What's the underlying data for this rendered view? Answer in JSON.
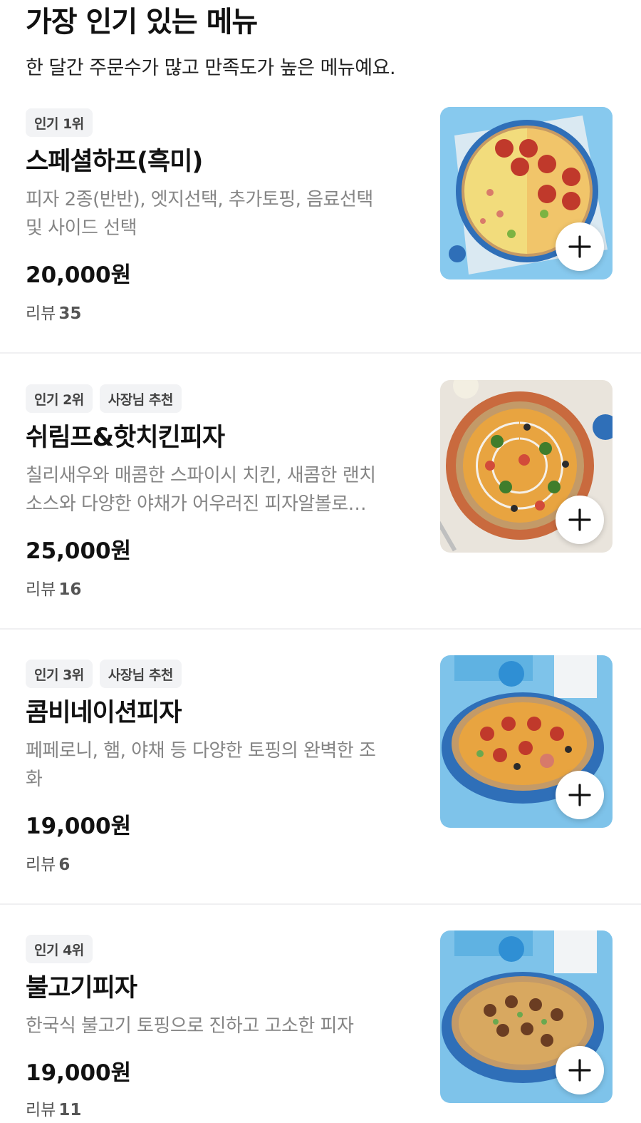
{
  "section": {
    "title": "가장 인기 있는 메뉴",
    "subtitle": "한 달간 주문수가 많고 만족도가 높은 메뉴예요."
  },
  "colors": {
    "badge_bg": "#f2f3f5",
    "divider": "#f0f0f2",
    "plate_blue": "#2f6fb8",
    "bg_blue": "#7ec3ea"
  },
  "items": [
    {
      "badges": [
        "인기 1위"
      ],
      "name": "스페셜하프(흑미)",
      "desc_lines": [
        "피자 2종(반반), 엣지선택, 추가토핑, 음료선택",
        "및 사이드 선택"
      ],
      "price": "20,000원",
      "reviews_label": "리뷰",
      "reviews_count": "35",
      "image_icon": "pizza-half-image"
    },
    {
      "badges": [
        "인기 2위",
        "사장님 추천"
      ],
      "name": "쉬림프&핫치킨피자",
      "desc_lines": [
        "칠리새우와 매콤한 스파이시 치킨, 새콤한 랜치",
        "소스와 다양한 야채가 어우러진 피자알볼로…"
      ],
      "price": "25,000원",
      "reviews_label": "리뷰",
      "reviews_count": "16",
      "image_icon": "shrimp-chicken-pizza-image"
    },
    {
      "badges": [
        "인기 3위",
        "사장님 추천"
      ],
      "name": "콤비네이션피자",
      "desc_lines": [
        "페페로니, 햄, 야채 등 다양한 토핑의 완벽한 조",
        "화"
      ],
      "price": "19,000원",
      "reviews_label": "리뷰",
      "reviews_count": "6",
      "image_icon": "combination-pizza-image"
    },
    {
      "badges": [
        "인기 4위"
      ],
      "name": "불고기피자",
      "desc_lines": [
        "한국식 불고기 토핑으로 진하고 고소한 피자"
      ],
      "price": "19,000원",
      "reviews_label": "리뷰",
      "reviews_count": "11",
      "image_icon": "bulgogi-pizza-image"
    }
  ]
}
